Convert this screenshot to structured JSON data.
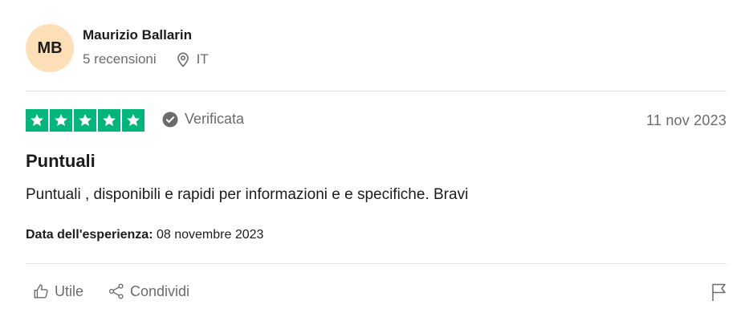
{
  "reviewer": {
    "initials": "MB",
    "name": "Maurizio Ballarin",
    "reviews": "5 recensioni",
    "country": "IT",
    "avatar_color": "#ffdfb8"
  },
  "review": {
    "rating": 5,
    "rating_max": 5,
    "star_color": "#00b67a",
    "verified_label": "Verificata",
    "date": "11 nov 2023",
    "title": "Puntuali",
    "text": "Puntuali , disponibili e rapidi per informazioni e e specifiche. Bravi",
    "experience_label": "Data dell'esperienza:",
    "experience_date": "08 novembre 2023"
  },
  "actions": {
    "useful_label": "Utile",
    "share_label": "Condividi"
  },
  "icons": [
    "location-pin-icon",
    "check-circle-icon",
    "star-icon",
    "thumbs-up-icon",
    "share-icon",
    "flag-icon"
  ]
}
